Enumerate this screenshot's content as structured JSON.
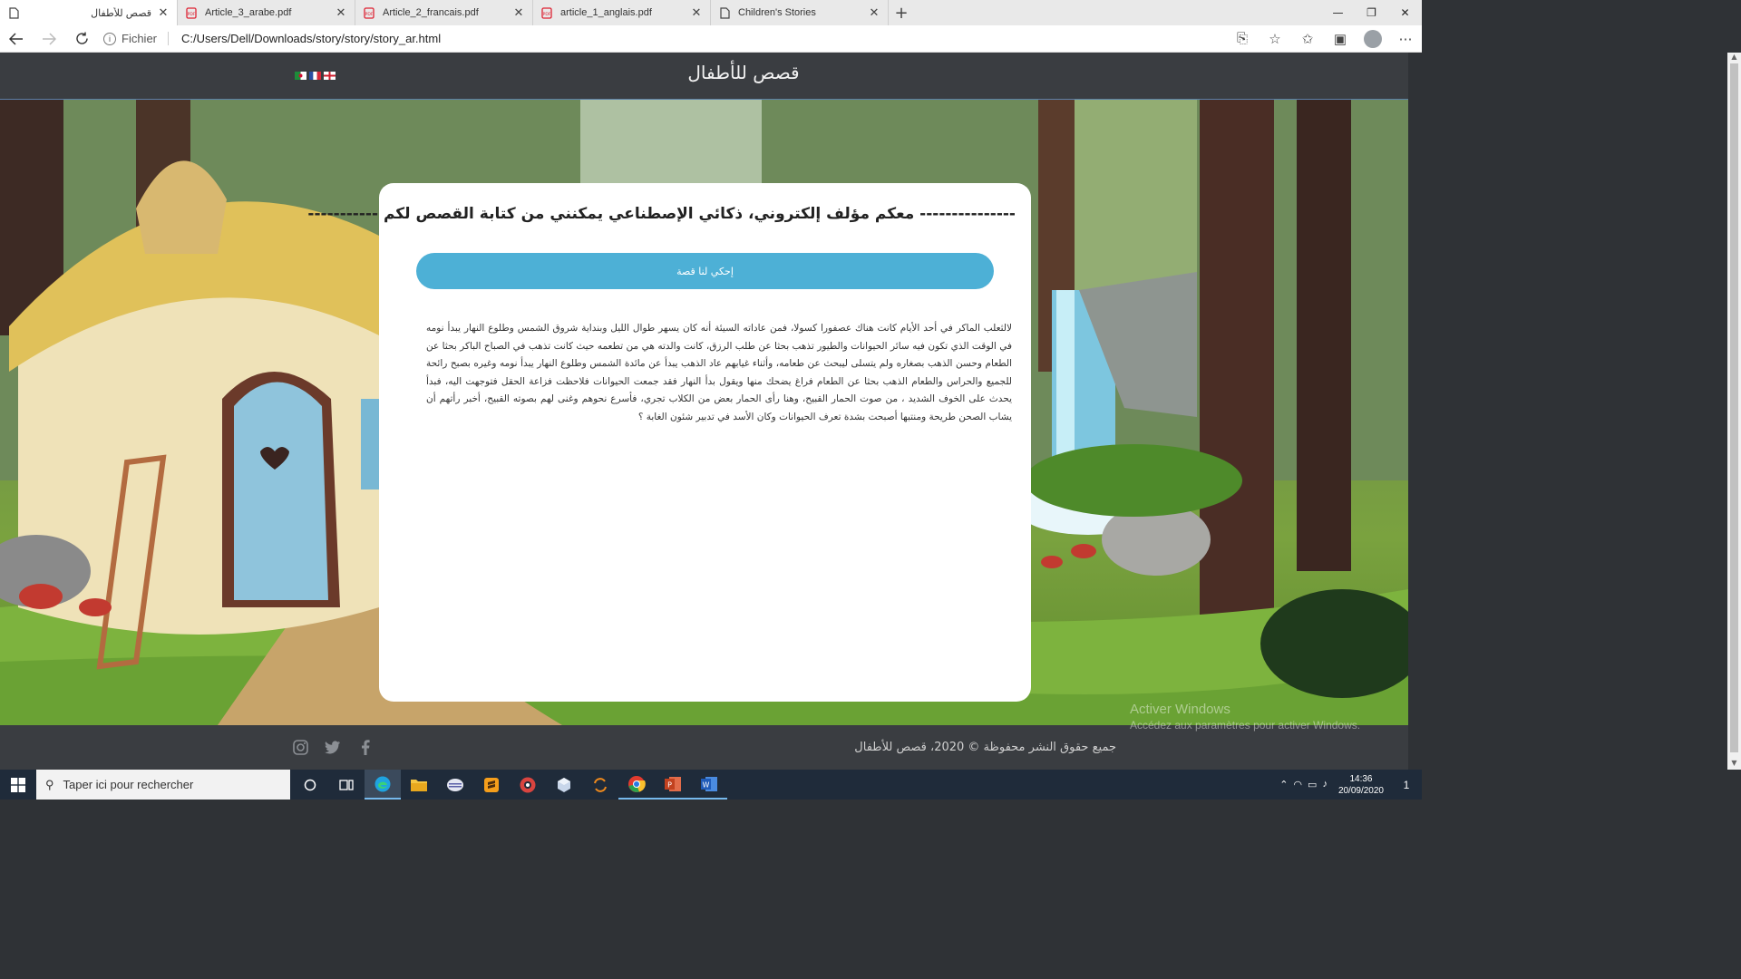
{
  "browser": {
    "tabs": [
      {
        "title": "قصص للأطفال",
        "icon": "page-icon",
        "active": true
      },
      {
        "title": "Article_3_arabe.pdf",
        "icon": "pdf-icon",
        "active": false
      },
      {
        "title": "Article_2_francais.pdf",
        "icon": "pdf-icon",
        "active": false
      },
      {
        "title": "article_1_anglais.pdf",
        "icon": "pdf-icon",
        "active": false
      },
      {
        "title": "Children's Stories",
        "icon": "page-icon",
        "active": false
      }
    ],
    "new_tab": "+",
    "window_controls": {
      "minimize": "—",
      "maximize": "❐",
      "close": "✕"
    },
    "address": {
      "scheme_label": "Fichier",
      "url": "C:/Users/Dell/Downloads/story/story/story_ar.html"
    }
  },
  "site": {
    "title": "قصص للأطفال",
    "heading": "--------------- معكم مؤلف إلكتروني، ذكائي الإصطناعي يمكنني من كتابة القصص لكم -----------",
    "tell_button": "إحكي لنا قصة",
    "story_text": "لالثعلب الماكر في أحد الأيام كانت هناك عصفورا كسولا، فمن عاداته السيئة أنه كان يسهر طوال الليل وبنداية شروق الشمس وطلوع النهار يبدأ نومه في الوقت الذي تكون فيه سائر الحيوانات والطيور تذهب بحثا عن طلب الرزق، كانت والدته هي من تطعمه حيث كانت تذهب في الصباح الباكر بحثا عن الطعام وحسن الذهب بصغاره ولم يتسلى ليبحث عن طعامه، وأثناء غيابهم عاد الذهب يبدأ عن مائدة الشمس وطلوع النهار يبدأ نومه وغيره بصبح رائحة للجميع والحراس والطعام الذهب بحثا عن الطعام فراغ يضحك منها ويقول بدأ النهار فقد جمعت الحيوانات فلاحظت فزاعة الحقل فتوجهت اليه، فبدأ يحدث على الخوف الشديد ، من صوت الحمار القبيح، وهنا رأى الحمار بعض من الكلاب تجري، فأسرع نحوهم وغنى لهم بصوته القبيح، أخبر رأتهم أن يشاب الصحن طريحة ومنتبها أصبحت بشدة تعرف الحيوانات وكان الأسد في تدبير شئون الغابة ؟",
    "footer_copyright": "جميع حقوق النشر محفوظة © 2020، قصص للأطفال"
  },
  "watermark": {
    "line1": "Activer Windows",
    "line2": "Accédez aux paramètres pour activer Windows."
  },
  "taskbar": {
    "search_placeholder": "Taper ici pour rechercher",
    "time": "14:36",
    "date": "20/09/2020",
    "notification_count": "1"
  }
}
